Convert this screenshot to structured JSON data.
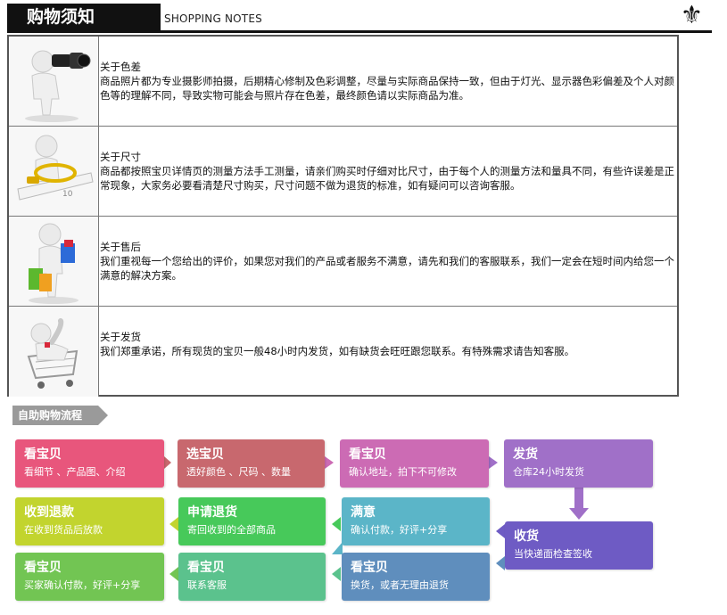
{
  "header": {
    "title": "购物须知",
    "subtitle": "SHOPPING NOTES",
    "ornament": "⚜"
  },
  "notes": [
    {
      "title": "关于色差",
      "body": "商品照片都为专业摄影师拍摄，后期精心修制及色彩调整，尽量与实际商品保持一致，但由于灯光、显示器色彩偏差及个人对颜色等的理解不同，导致实物可能会与照片存在色差，最终颜色请以实际商品为准。",
      "icon": "photographer-figure-icon"
    },
    {
      "title": "关于尺寸",
      "body": "商品都按照宝贝详情页的测量方法手工测量，请亲们购买时仔细对比尺寸，由于每个人的测量方法和量具不同，有些许误差是正常现象，大家务必要看清楚尺寸购买，尺寸问题不做为退货的标准，如有疑问可以咨询客服。",
      "icon": "measuring-tape-figure-icon"
    },
    {
      "title": "关于售后",
      "body": "我们重视每一个您给出的评价，如果您对我们的产品或者服务不满意，请先和我们的客服联系，我们一定会在短时间内给您一个满意的解决方案。",
      "icon": "shopping-bags-figure-icon"
    },
    {
      "title": "关于发货",
      "body": "我们郑重承诺，所有现货的宝贝一般48小时内发货，如有缺货会旺旺跟您联系。有特殊需求请告知客服。",
      "icon": "shopping-cart-figure-icon"
    }
  ],
  "flow": {
    "label": "自助购物流程",
    "steps": [
      {
        "title": "看宝贝",
        "desc": "看细节 、产品图、介绍",
        "color": "#e8567c"
      },
      {
        "title": "选宝贝",
        "desc": "透好颜色 、尺码 、数量",
        "color": "#c8686e"
      },
      {
        "title": "看宝贝",
        "desc": "确认地址，拍下不可修改",
        "color": "#cc6bb4"
      },
      {
        "title": "发货",
        "desc": "仓库24小时发货",
        "color": "#a070c8"
      },
      {
        "title": "收货",
        "desc": "当快递面检查签收",
        "color": "#6e5bc4"
      },
      {
        "title": "满意",
        "desc": "确认付款，好评+分享",
        "color": "#5bb5c8"
      },
      {
        "title": "看宝贝",
        "desc": "换货，或者无理由退货",
        "color": "#5f8ebd"
      },
      {
        "title": "申请退货",
        "desc": "寄回收到的全部商品",
        "color": "#47c95a"
      },
      {
        "title": "收到退款",
        "desc": "在收到货品后放款",
        "color": "#c2d42e"
      },
      {
        "title": "看宝贝",
        "desc": "买家确认付款，好评+分享",
        "color": "#72c553"
      },
      {
        "title": "看宝贝",
        "desc": "联系客服",
        "color": "#5bc28d"
      }
    ]
  }
}
